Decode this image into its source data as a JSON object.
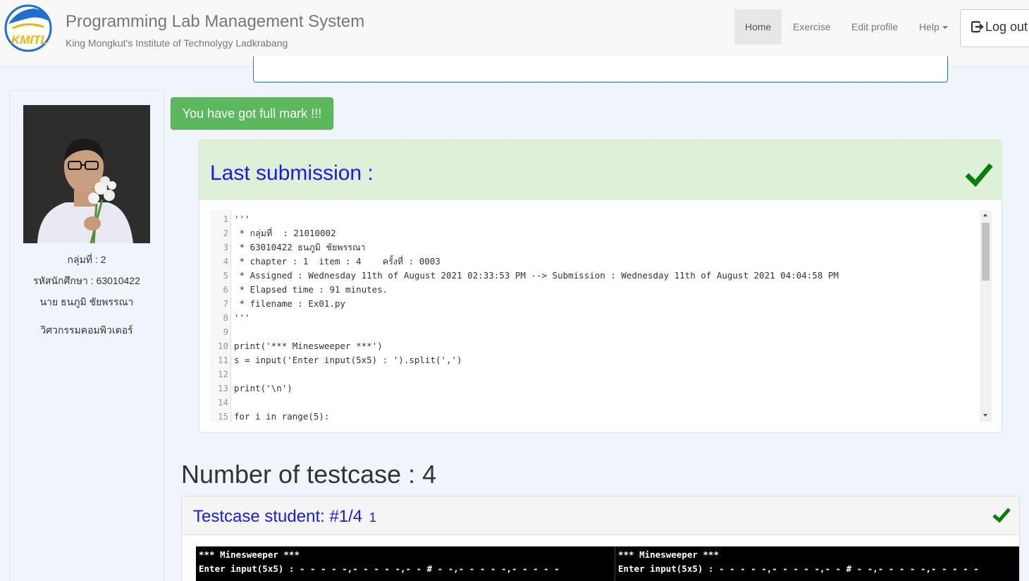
{
  "brand": {
    "logo_text": "KMITL",
    "title": "Programming Lab Management System",
    "subtitle": "King Mongkut's Institute of Technolygy Ladkrabang"
  },
  "nav": {
    "home": "Home",
    "exercise": "Exercise",
    "edit_profile": "Edit profile",
    "help": "Help",
    "logout": "Log out"
  },
  "profile": {
    "group": "กลุ่มที่ : 2",
    "student_id": "รหัสนักศึกษา : 63010422",
    "name": "นาย ธนภูมิ ชัยพรรณา",
    "department": "วิศวกรรมคอมพิวเตอร์"
  },
  "full_mark": "You have got full mark !!!",
  "submission": {
    "title": "Last submission :",
    "code_lines": [
      "'''",
      " * กลุ่มที่  : 21010002",
      " * 63010422 ธนภูมิ ชัยพรรณา",
      " * chapter : 1  item : 4    ครั้งที่ : 0003",
      " * Assigned : Wednesday 11th of August 2021 02:33:53 PM --> Submission : Wednesday 11th of August 2021 04:04:58 PM",
      " * Elapsed time : 91 minutes.",
      " * filename : Ex01.py",
      "'''",
      "",
      "print('*** Minesweeper ***')",
      "s = input('Enter input(5x5) : ').split(',')",
      "",
      "print('\\n')",
      "",
      "for i in range(5):"
    ]
  },
  "testcases": {
    "heading": "Number of testcase : 4",
    "current_title": "Testcase student: #1/4",
    "current_badge": "1",
    "expected_output": "*** Minesweeper ***\nEnter input(5x5) : - - - - -,- - - - -,- - # - -,- - - - -,- - - - -",
    "student_output": "*** Minesweeper ***\nEnter input(5x5) : - - - - -,- - - - -,- - # - -,- - - - -,- - - - -"
  },
  "colors": {
    "success_green": "#5cb85c",
    "check_green": "#008000",
    "title_blue": "#1a1aee"
  }
}
